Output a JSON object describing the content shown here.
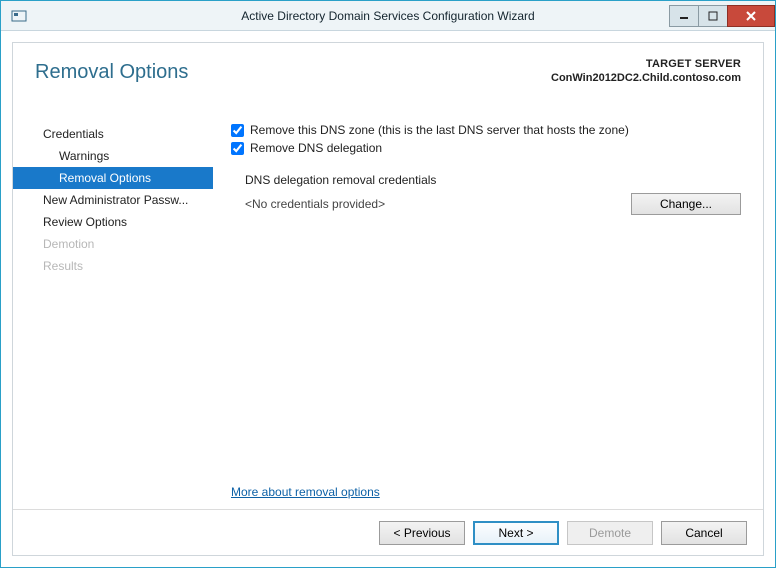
{
  "window": {
    "title": "Active Directory Domain Services Configuration Wizard"
  },
  "header": {
    "page_title": "Removal Options",
    "target_label": "TARGET SERVER",
    "target_host": "ConWin2012DC2.Child.contoso.com"
  },
  "sidebar": {
    "items": [
      {
        "label": "Credentials",
        "sub": false,
        "active": false,
        "disabled": false
      },
      {
        "label": "Warnings",
        "sub": true,
        "active": false,
        "disabled": false
      },
      {
        "label": "Removal Options",
        "sub": true,
        "active": true,
        "disabled": false
      },
      {
        "label": "New Administrator Passw...",
        "sub": false,
        "active": false,
        "disabled": false
      },
      {
        "label": "Review Options",
        "sub": false,
        "active": false,
        "disabled": false
      },
      {
        "label": "Demotion",
        "sub": false,
        "active": false,
        "disabled": true
      },
      {
        "label": "Results",
        "sub": false,
        "active": false,
        "disabled": true
      }
    ]
  },
  "content": {
    "check_remove_zone": {
      "checked": true,
      "label": "Remove this DNS zone (this is the last DNS server that hosts the zone)"
    },
    "check_remove_delegation": {
      "checked": true,
      "label": "Remove DNS delegation"
    },
    "delegation_section": "DNS delegation removal credentials",
    "credentials_text": "<No credentials provided>",
    "change_button": "Change...",
    "more_link": "More about removal options"
  },
  "footer": {
    "previous": "< Previous",
    "next": "Next >",
    "demote": "Demote",
    "cancel": "Cancel"
  }
}
